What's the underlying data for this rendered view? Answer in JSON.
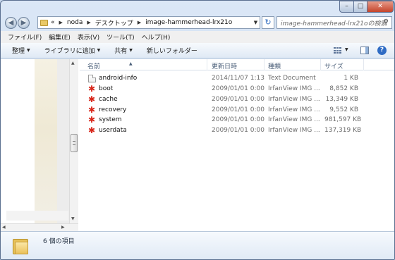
{
  "titlebar": {
    "breadcrumbs": [
      "noda",
      "デスクトップ",
      "image-hammerhead-lrx21o"
    ],
    "overflow_marker": "«",
    "search_placeholder": "image-hammerhead-lrx21oの検索"
  },
  "menu": [
    "ファイル(F)",
    "編集(E)",
    "表示(V)",
    "ツール(T)",
    "ヘルプ(H)"
  ],
  "commands": [
    "整理",
    "ライブラリに追加",
    "共有",
    "新しいフォルダー"
  ],
  "columns": {
    "name": "名前",
    "date": "更新日時",
    "type": "種類",
    "size": "サイズ"
  },
  "files": [
    {
      "name": "android-info",
      "date": "2014/11/07 1:13",
      "type": "Text Document",
      "size": "1 KB",
      "icon": "text-document-icon"
    },
    {
      "name": "boot",
      "date": "2009/01/01 0:00",
      "type": "IrfanView IMG ...",
      "size": "8,852 KB",
      "icon": "irfanview-icon"
    },
    {
      "name": "cache",
      "date": "2009/01/01 0:00",
      "type": "IrfanView IMG ...",
      "size": "13,349 KB",
      "icon": "irfanview-icon"
    },
    {
      "name": "recovery",
      "date": "2009/01/01 0:00",
      "type": "IrfanView IMG ...",
      "size": "9,552 KB",
      "icon": "irfanview-icon"
    },
    {
      "name": "system",
      "date": "2009/01/01 0:00",
      "type": "IrfanView IMG ...",
      "size": "981,597 KB",
      "icon": "irfanview-icon"
    },
    {
      "name": "userdata",
      "date": "2009/01/01 0:00",
      "type": "IrfanView IMG ...",
      "size": "137,319 KB",
      "icon": "irfanview-icon"
    }
  ],
  "details": {
    "item_count": "6 個の項目"
  },
  "colors": {
    "accent": "#2e6bc4",
    "close": "#c4442b",
    "irfanview": "#d8261a"
  }
}
